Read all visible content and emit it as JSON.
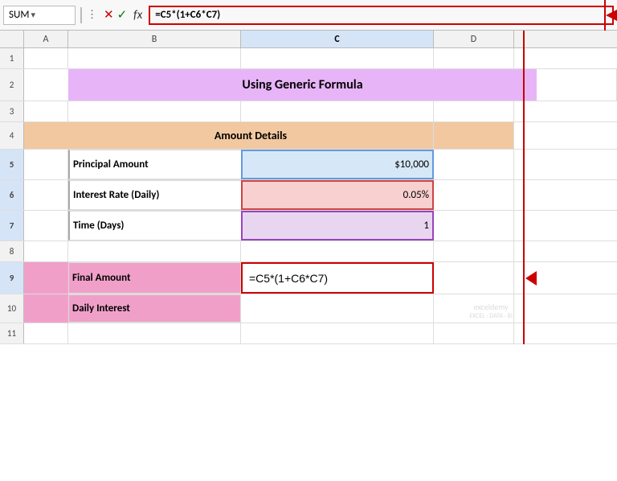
{
  "nameBox": {
    "value": "SUM",
    "arrowLabel": "▾"
  },
  "formulaBar": {
    "crossIcon": "✕",
    "checkIcon": "✓",
    "fxLabel": "fx",
    "formula": "=C5*(1+C6*C7)"
  },
  "columns": {
    "headers": [
      "A",
      "B",
      "C",
      "D"
    ]
  },
  "rows": {
    "numbers": [
      "1",
      "2",
      "3",
      "4",
      "5",
      "6",
      "7",
      "8",
      "9",
      "10",
      "11"
    ]
  },
  "cells": {
    "row2_title": "Using Generic Formula",
    "row4_header": "Amount Details",
    "row5_label": "Principal Amount",
    "row5_value": "$10,000",
    "row6_label": "Interest Rate (Daily)",
    "row6_value": "0.05%",
    "row7_label": "Time (Days)",
    "row7_value": "1",
    "row9_label": "Final Amount",
    "row9_formula": "=C5*(1+C6*C7)",
    "row10_label": "Daily Interest"
  }
}
